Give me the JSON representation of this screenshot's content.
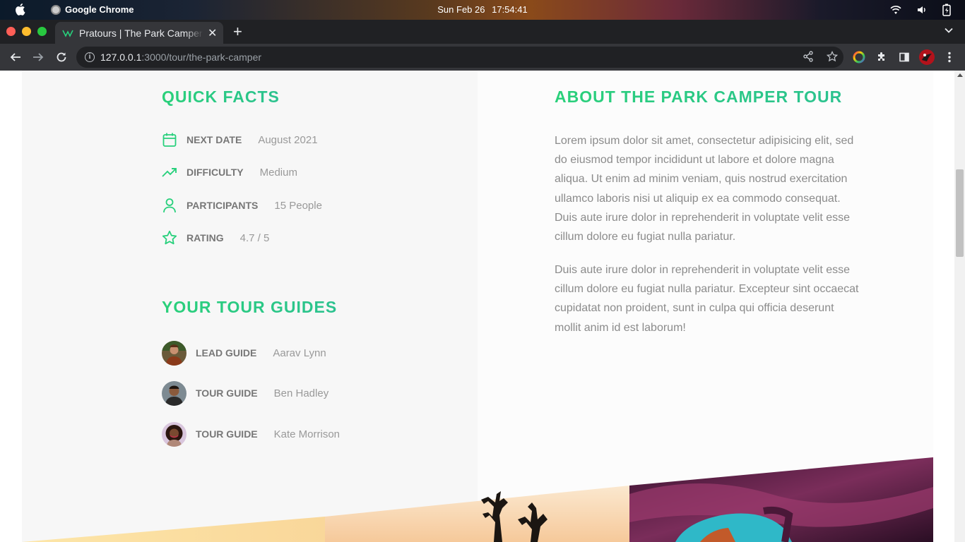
{
  "os": {
    "app_name": "Google Chrome",
    "date": "Sun Feb 26",
    "time": "17:54:41"
  },
  "browser": {
    "tab_title": "Pratours | The Park Camper",
    "url_host": "127.0.0.1",
    "url_path": ":3000/tour/the-park-camper"
  },
  "quick_facts": {
    "heading": "Quick Facts",
    "items": [
      {
        "label": "Next Date",
        "value": "August 2021",
        "icon": "calendar-icon"
      },
      {
        "label": "Difficulty",
        "value": "Medium",
        "icon": "trending-up-icon"
      },
      {
        "label": "Participants",
        "value": "15 People",
        "icon": "user-icon"
      },
      {
        "label": "Rating",
        "value": "4.7 / 5",
        "icon": "star-icon"
      }
    ]
  },
  "guides": {
    "heading": "Your Tour Guides",
    "items": [
      {
        "role": "Lead Guide",
        "name": "Aarav Lynn"
      },
      {
        "role": "Tour Guide",
        "name": "Ben Hadley"
      },
      {
        "role": "Tour Guide",
        "name": "Kate Morrison"
      }
    ]
  },
  "about": {
    "heading": "About The Park Camper Tour",
    "paragraphs": [
      "Lorem ipsum dolor sit amet, consectetur adipisicing elit, sed do eiusmod tempor incididunt ut labore et dolore magna aliqua. Ut enim ad minim veniam, quis nostrud exercitation ullamco laboris nisi ut aliquip ex ea commodo consequat. Duis aute irure dolor in reprehenderit in voluptate velit esse cillum dolore eu fugiat nulla pariatur.",
      "Duis aute irure dolor in reprehenderit in voluptate velit esse cillum dolore eu fugiat nulla pariatur. Excepteur sint occaecat cupidatat non proident, sunt in culpa qui officia deserunt mollit anim id est laborum!"
    ]
  },
  "colors": {
    "accent": "#28d07c",
    "label": "#777777",
    "value": "#999999"
  }
}
